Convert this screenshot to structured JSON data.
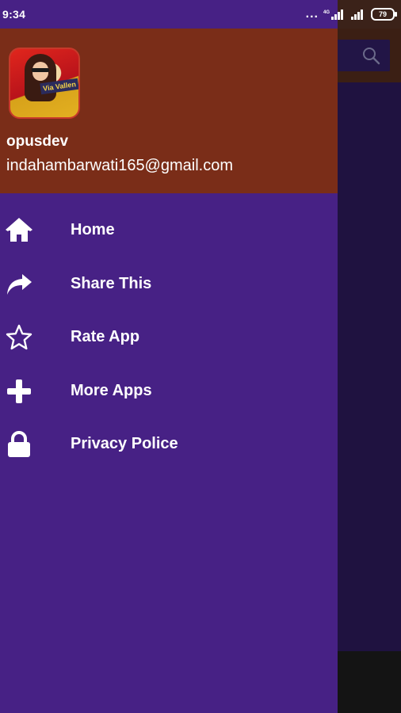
{
  "status_bar": {
    "time": "9:34",
    "notification_dots": "...",
    "network_label": "4G",
    "battery_level": "79"
  },
  "drawer": {
    "profile": {
      "name": "opusdev",
      "email": "indahambarwati165@gmail.com",
      "avatar_caption": "Via Vallen"
    },
    "menu_items": [
      {
        "label": "Home",
        "icon": "home-icon"
      },
      {
        "label": "Share This",
        "icon": "share-icon"
      },
      {
        "label": "Rate App",
        "icon": "star-icon"
      },
      {
        "label": "More Apps",
        "icon": "plus-icon"
      },
      {
        "label": "Privacy Police",
        "icon": "lock-icon"
      }
    ]
  },
  "colors": {
    "drawer_background": "#472185",
    "header_background": "#7a2d18",
    "scrim_background": "#1f1240",
    "text": "#ffffff"
  }
}
